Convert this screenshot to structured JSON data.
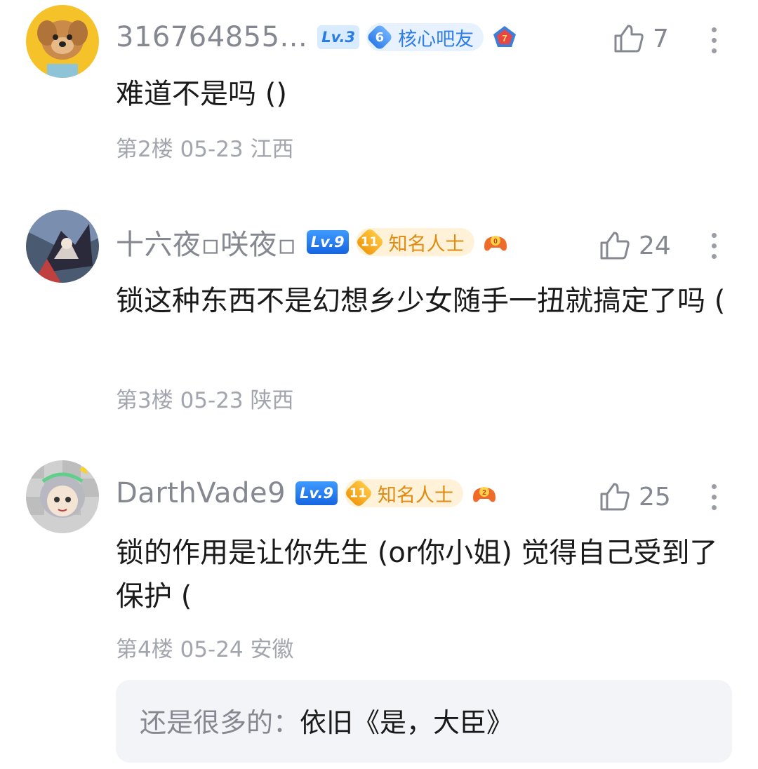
{
  "posts": [
    {
      "username": "316764855...",
      "level": "Lv.3",
      "badge": {
        "num": "6",
        "label": "核心吧友"
      },
      "medal": "7",
      "likes": "7",
      "content": "难道不是吗 ()",
      "meta": "第2楼 05-23 江西"
    },
    {
      "username": "十六夜▫咲夜▫",
      "level": "Lv.9",
      "badge": {
        "num": "11",
        "label": "知名人士"
      },
      "medal": "0",
      "likes": "24",
      "content": "锁这种东西不是幻想乡少女随手一扭就搞定了吗 (",
      "meta": "第3楼 05-23 陕西"
    },
    {
      "username": "DarthVade9",
      "level": "Lv.9",
      "badge": {
        "num": "11",
        "label": "知名人士"
      },
      "medal": "2",
      "likes": "25",
      "content": "锁的作用是让你先生 (or你小姐) 觉得自己受到了保护 (",
      "meta": "第4楼 05-24 安徽",
      "reply": {
        "name": "还是很多的：",
        "text": "依旧《是，大臣》"
      }
    }
  ],
  "icons": {
    "like": "thumbs-up-icon",
    "more": "more-vertical-icon"
  },
  "colors": {
    "level_blue": "#2a7be4",
    "badge_gold": "#e08a10",
    "meta_gray": "#a2a5ad"
  }
}
